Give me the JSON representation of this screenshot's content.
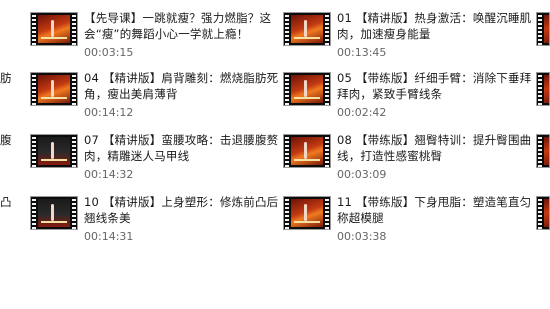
{
  "items": [
    {
      "title": "【先导课】一跳就瘦？强力燃脂？这会“瘦”的舞蹈小心一学就上瘾！",
      "duration": "00:03:15"
    },
    {
      "title": "01 【精讲版】热身激活：唤醒沉睡肌肉，加速瘦身能量",
      "duration": "00:13:45"
    },
    {
      "title": "04 【精讲版】肩背雕刻：燃烧脂肪死角，瘦出美肩薄背",
      "duration": "00:14:12"
    },
    {
      "title": "05 【带练版】纤细手臂：消除下垂拜拜肉，紧致手臂线条",
      "duration": "00:02:42"
    },
    {
      "title": "07 【精讲版】蛮腰攻略：击退腰腹赘肉，精雕迷人马甲线",
      "duration": "00:14:32"
    },
    {
      "title": "08 【带练版】翘臀特训：提升臀围曲线，打造性感蜜桃臀",
      "duration": "00:03:09"
    },
    {
      "title": "10 【精讲版】上身塑形：修炼前凸后翘线条美",
      "duration": "00:14:31"
    },
    {
      "title": "11 【带练版】下身甩脂：塑造笔直匀称超模腿",
      "duration": "00:03:38"
    }
  ],
  "left_edge_fragments": [
    "肪",
    "腹",
    "凸"
  ]
}
